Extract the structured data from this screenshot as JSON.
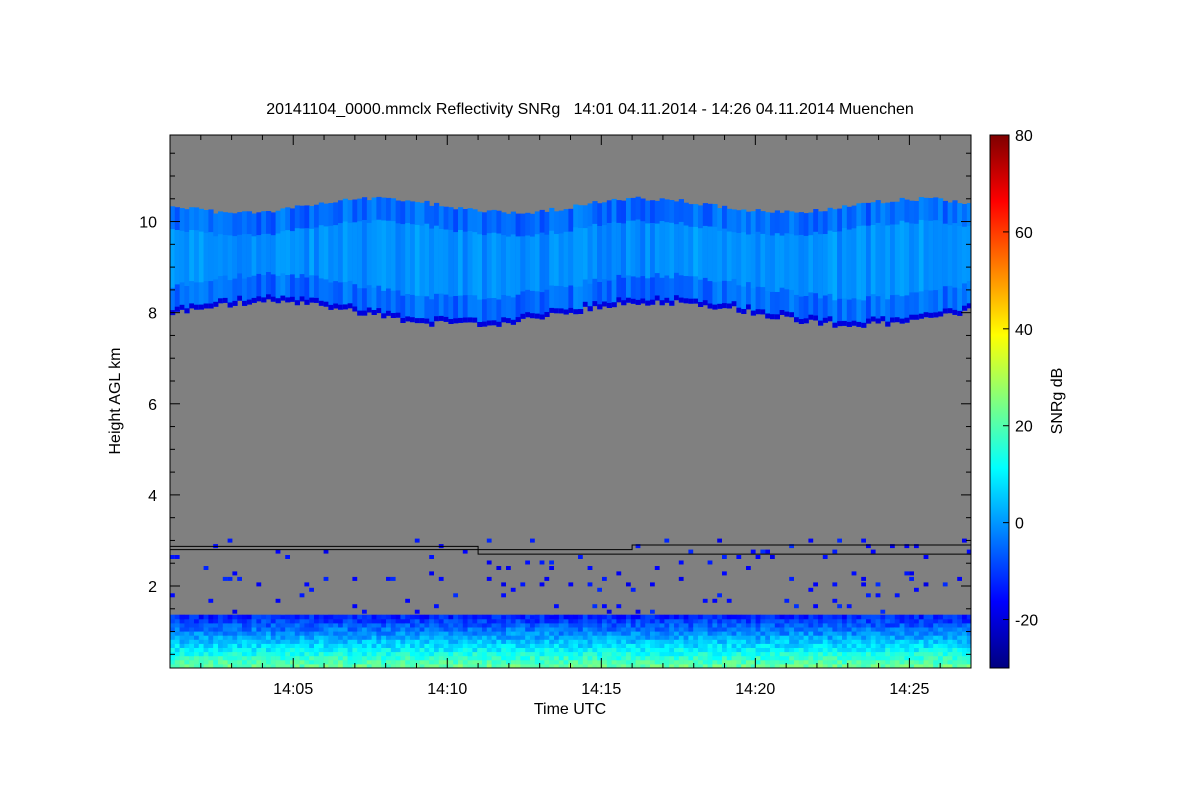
{
  "chart_data": {
    "type": "heatmap",
    "title": "20141104_0000.mmclx Reflectivity SNRg   14:01 04.11.2014 - 14:26 04.11.2014 Muenchen",
    "xlabel": "Time UTC",
    "ylabel": "Height AGL km",
    "xlim": [
      "14:01",
      "14:27"
    ],
    "ylim": [
      0.2,
      11.9
    ],
    "x_ticks": [
      "14:05",
      "14:10",
      "14:15",
      "14:20",
      "14:25"
    ],
    "y_ticks": [
      2,
      4,
      6,
      8,
      10
    ],
    "colorbar": {
      "label": "SNRg dB",
      "range": [
        -30,
        80
      ],
      "ticks": [
        -20,
        0,
        20,
        40,
        60,
        80
      ],
      "colormap": "jet"
    },
    "no_signal_color": "#808080",
    "regions": [
      {
        "name": "cirrus_layer",
        "x_start": "14:01",
        "x_end": "14:27",
        "bottom_km": 8.0,
        "top_km": 10.4,
        "snr_db": -5
      },
      {
        "name": "boundary_layer_clutter",
        "x_start": "14:01",
        "x_end": "14:27",
        "bottom_km": 0.2,
        "top_km": 1.3,
        "snr_db": 10
      },
      {
        "name": "scattered_echoes",
        "x_start": "14:01",
        "x_end": "14:27",
        "bottom_km": 1.3,
        "top_km": 3.1,
        "snr_db": -15
      }
    ],
    "lines": [
      {
        "name": "upper_reference_line",
        "x": [
          "14:01",
          "14:11",
          "14:11",
          "14:16",
          "14:16",
          "14:27"
        ],
        "y": [
          2.87,
          2.87,
          2.8,
          2.8,
          2.9,
          2.9
        ]
      },
      {
        "name": "lower_reference_line",
        "x": [
          "14:01",
          "14:11",
          "14:11",
          "14:27"
        ],
        "y": [
          2.8,
          2.8,
          2.7,
          2.7
        ]
      }
    ]
  }
}
